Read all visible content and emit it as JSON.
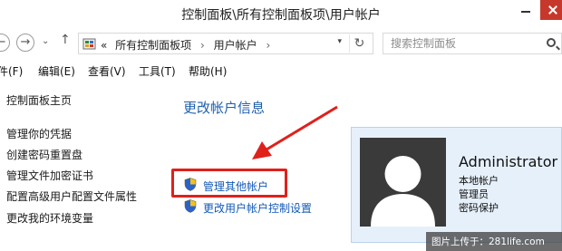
{
  "window": {
    "title": "控制面板\\所有控制面板项\\用户帐户"
  },
  "navigation": {
    "back_glyph": "←",
    "forward_glyph": "→",
    "dropdown_glyph": "⌄",
    "up_glyph": "↑",
    "breadcrumb": {
      "prefix": "«",
      "items": [
        "所有控制面板项",
        "用户帐户"
      ],
      "separator": "›",
      "dropdown_glyph": "▾"
    },
    "refresh_glyph": "↻",
    "search_placeholder": "搜索控制面板"
  },
  "menubar": {
    "items": [
      "件(F)",
      "编辑(E)",
      "查看(V)",
      "工具(T)",
      "帮助(H)"
    ]
  },
  "sidebar": {
    "items": [
      "控制面板主页",
      "管理你的凭据",
      "创建密码重置盘",
      "管理文件加密证书",
      "配置高级用户配置文件属性",
      "更改我的环境变量"
    ]
  },
  "main": {
    "section_title": "更改帐户信息",
    "tasks": [
      "管理其他帐户",
      "更改用户帐户控制设置"
    ]
  },
  "user_card": {
    "name": "Administrator",
    "details": [
      "本地帐户",
      "管理员",
      "密码保护"
    ]
  },
  "watermark": {
    "text": "图片上传于：281life.com"
  },
  "colors": {
    "link": "#1259b8",
    "section_title": "#1e5fae",
    "highlight": "#e0201b",
    "card_bg": "#e6f0fb",
    "close_button": "#c7382c"
  },
  "icons": {
    "window_close": "close-icon",
    "window_minimize": "minimize-icon",
    "breadcrumb_root": "control-panel-icon",
    "task": "uac-shield-icon",
    "search": "search-icon"
  }
}
